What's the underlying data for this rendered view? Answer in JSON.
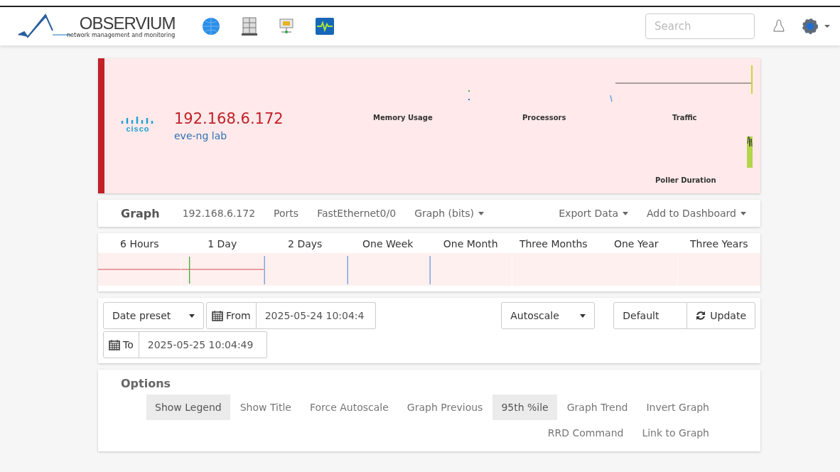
{
  "header": {
    "logo_text": "OBSERVIUM",
    "logo_tagline": "network management and monitoring",
    "search": {
      "placeholder": "Search"
    }
  },
  "device": {
    "alert": true,
    "vendor_logo": "cisco",
    "hostname": "192.168.6.172",
    "location": "eve-ng lab",
    "mini_graphs": [
      {
        "title": "Memory Usage",
        "kind": "dots"
      },
      {
        "title": "Processors",
        "kind": "tick"
      },
      {
        "title": "Traffic",
        "kind": "flat"
      },
      {
        "title": "Poller Duration",
        "kind": "spike"
      }
    ]
  },
  "nav": {
    "title": "Graph",
    "items": [
      {
        "label": "192.168.6.172",
        "dropdown": false
      },
      {
        "label": "Ports",
        "dropdown": false
      },
      {
        "label": "FastEthernet0/0",
        "dropdown": false
      },
      {
        "label": "Graph (bits)",
        "dropdown": true
      }
    ],
    "right_items": [
      {
        "label": "Export Data",
        "dropdown": true
      },
      {
        "label": "Add to Dashboard",
        "dropdown": true
      }
    ]
  },
  "periods": [
    {
      "label": "6 Hours",
      "kind": "flat"
    },
    {
      "label": "1 Day",
      "kind": "flat"
    },
    {
      "label": "2 Days",
      "kind": "edge"
    },
    {
      "label": "One Week",
      "kind": "edge"
    },
    {
      "label": "One Month",
      "kind": "edge"
    },
    {
      "label": "Three Months",
      "kind": "empty"
    },
    {
      "label": "One Year",
      "kind": "empty"
    },
    {
      "label": "Three Years",
      "kind": "empty"
    }
  ],
  "controls": {
    "date_presets": "Date preset",
    "from_label": "From",
    "from_value": "2025-05-24 10:04:4",
    "to_label": "To",
    "to_value": "2025-05-25 10:04:49",
    "scale": "Autoscale",
    "style": "Default",
    "update": "Update"
  },
  "options": {
    "title": "Options",
    "buttons": [
      {
        "label": "Show Legend",
        "selected": true
      },
      {
        "label": "Show Title",
        "selected": false
      },
      {
        "label": "Force Autoscale",
        "selected": false
      },
      {
        "label": "Graph Previous",
        "selected": false
      },
      {
        "label": "95th %ile",
        "selected": true
      },
      {
        "label": "Graph Trend",
        "selected": false
      },
      {
        "label": "Invert Graph",
        "selected": false
      },
      {
        "label": "RRD Command",
        "selected": false
      },
      {
        "label": "Link to Graph",
        "selected": false
      }
    ]
  }
}
